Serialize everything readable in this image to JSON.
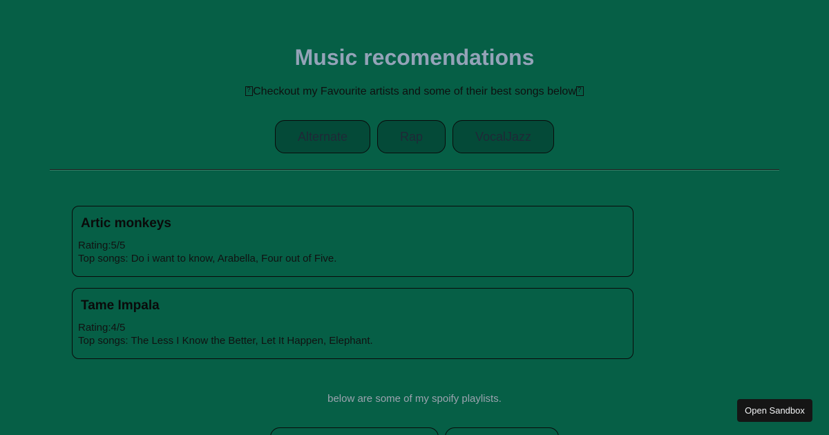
{
  "header": {
    "title": "Music recomendations",
    "tagline": "Checkout my Favourite artists and some of their best songs below"
  },
  "genres": [
    {
      "label": "Alternate"
    },
    {
      "label": "Rap"
    },
    {
      "label": "VocalJazz"
    }
  ],
  "artists": [
    {
      "name": "Artic monkeys",
      "rating": "Rating:5/5",
      "top_songs": "Top songs: Do i want to know, Arabella, Four out of Five."
    },
    {
      "name": "Tame Impala",
      "rating": "Rating:4/5",
      "top_songs": "Top songs: The Less I Know the Better, Let It Happen, Elephant."
    }
  ],
  "playlists": {
    "note": "below are some of my spoify playlists."
  },
  "sandbox": {
    "label": "Open Sandbox"
  },
  "colors": {
    "background": "#065f46",
    "title": "#94a3b8",
    "button_fill": "#044a38",
    "sandbox_button": "#151515"
  }
}
